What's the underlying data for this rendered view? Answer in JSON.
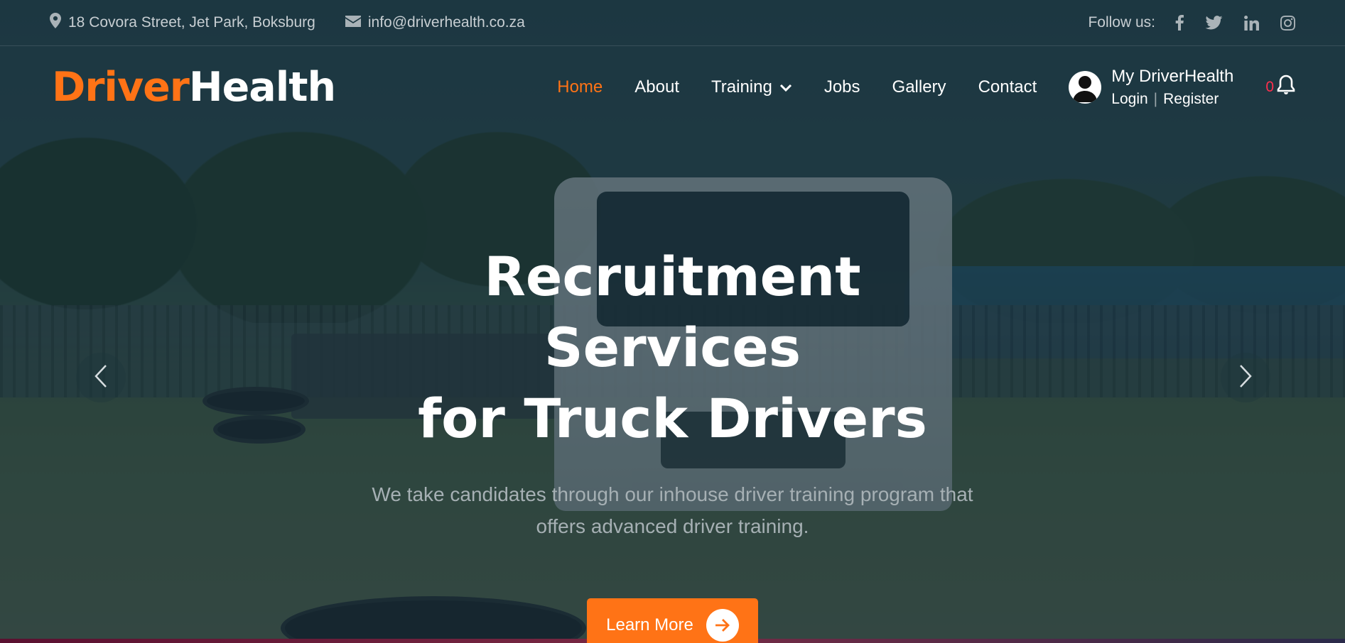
{
  "topbar": {
    "address": "18 Covora Street, Jet Park, Boksburg",
    "email": "info@driverhealth.co.za",
    "follow_label": "Follow us:",
    "social_icons": [
      "facebook-icon",
      "twitter-icon",
      "linkedin-icon",
      "instagram-icon"
    ]
  },
  "header": {
    "logo_part1": "Driver",
    "logo_part2": "Health",
    "nav": {
      "home": "Home",
      "about": "About",
      "training": "Training",
      "jobs": "Jobs",
      "gallery": "Gallery",
      "contact": "Contact"
    },
    "account": {
      "title": "My DriverHealth",
      "login": "Login",
      "separator": "|",
      "register": "Register"
    },
    "notifications": {
      "count": "0"
    }
  },
  "hero": {
    "title_line1": "Recruitment Services",
    "title_line2": "for Truck Drivers",
    "subtitle": "We take candidates through our inhouse driver training program that offers advanced driver training.",
    "cta_label": "Learn More"
  },
  "colors": {
    "accent": "#ff7316",
    "badge": "#ff2f4d"
  }
}
